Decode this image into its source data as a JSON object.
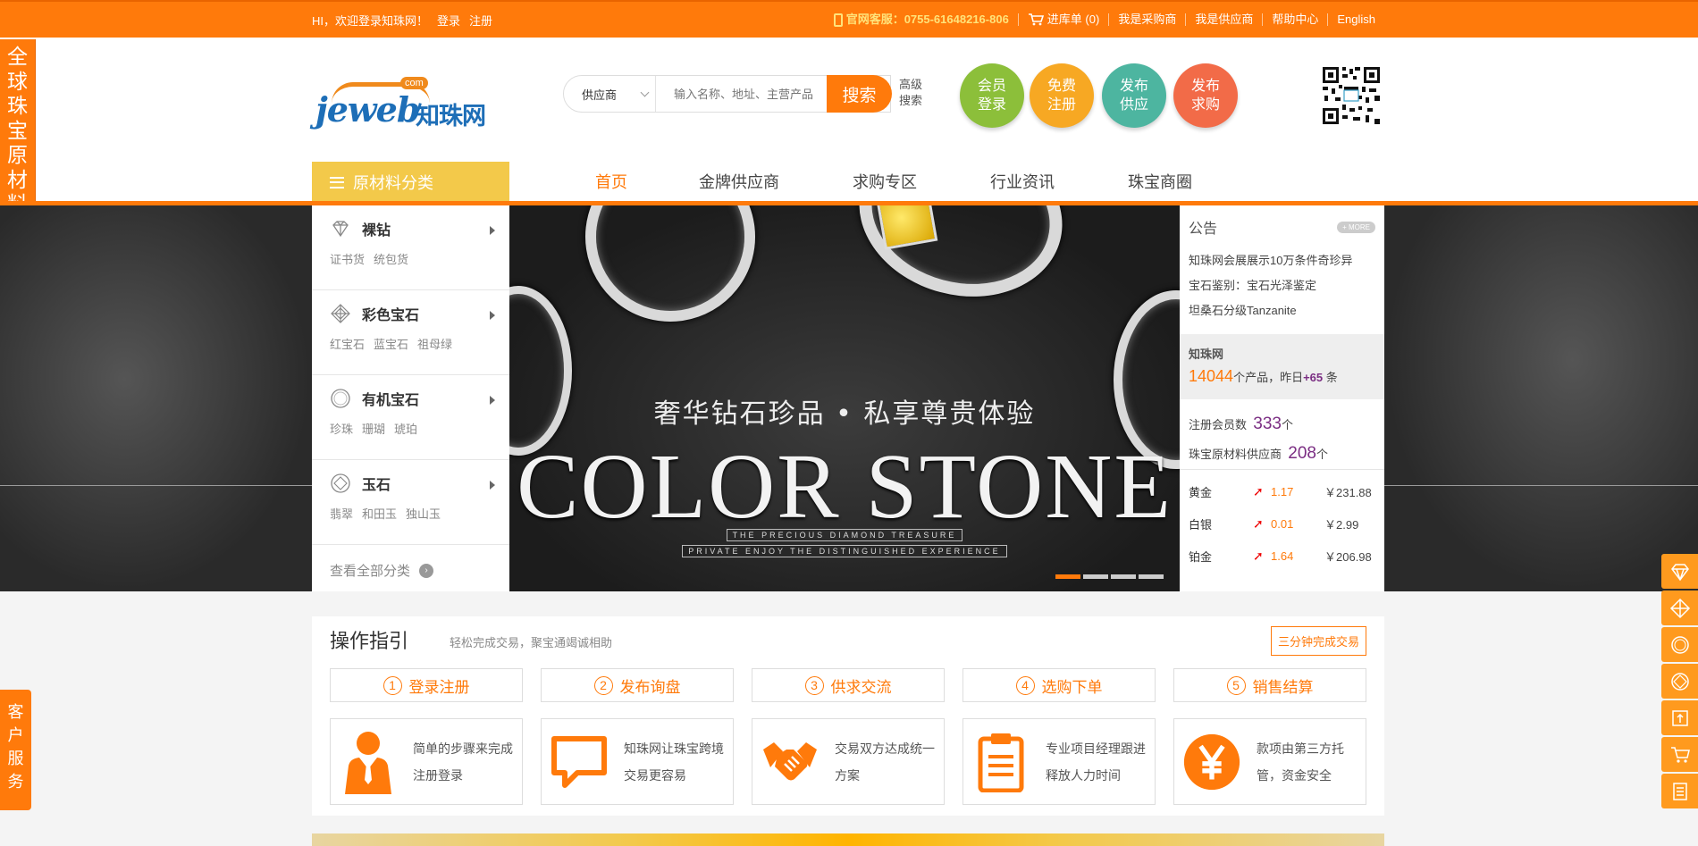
{
  "topbar": {
    "greeting": "HI，欢迎登录知珠网！",
    "login": "登录",
    "register": "注册",
    "hotline": "官网客服：0755-61648216-806",
    "cart": "进库单 (0)",
    "buyer": "我是采购商",
    "supplier": "我是供应商",
    "help": "帮助中心",
    "english": "English"
  },
  "left_banner": {
    "text": "全球珠宝原材料采销平台"
  },
  "left_service": {
    "text": "客户服务"
  },
  "logo": {
    "en": "jeweb",
    "cn": "知珠网",
    "badge": "com"
  },
  "search": {
    "scope": "供应商",
    "placeholder": "输入名称、地址、主营产品",
    "button": "搜索",
    "advanced_1": "高级",
    "advanced_2": "搜索"
  },
  "quick_buttons": [
    {
      "label_1": "会员",
      "label_2": "登录",
      "color": "#8cbf3a"
    },
    {
      "label_1": "免费",
      "label_2": "注册",
      "color": "#f7a823"
    },
    {
      "label_1": "发布",
      "label_2": "供应",
      "color": "#4db5a0"
    },
    {
      "label_1": "发布",
      "label_2": "求购",
      "color": "#f26b48"
    }
  ],
  "nav": {
    "category_title": "原材料分类",
    "items": [
      "首页",
      "金牌供应商",
      "求购专区",
      "行业资讯",
      "珠宝商圈"
    ]
  },
  "categories": [
    {
      "title": "裸钻",
      "subs": [
        "证书货",
        "统包货"
      ],
      "icon": "diamond-icon"
    },
    {
      "title": "彩色宝石",
      "subs": [
        "红宝石",
        "蓝宝石",
        "祖母绿"
      ],
      "icon": "gem-icon"
    },
    {
      "title": "有机宝石",
      "subs": [
        "珍珠",
        "珊瑚",
        "琥珀"
      ],
      "icon": "pearl-icon"
    },
    {
      "title": "玉石",
      "subs": [
        "翡翠",
        "和田玉",
        "独山玉"
      ],
      "icon": "jade-icon"
    }
  ],
  "category_all": "查看全部分类",
  "slider": {
    "tagline": "奢华钻石珍品 • 私享尊贵体验",
    "headline": "COLOR STONE",
    "sub1": "THE PRECIOUS DIAMOND TREASURE",
    "sub2": "PRIVATE ENJOY THE DISTINGUISHED EXPERIENCE",
    "active_slide": 1,
    "slide_count": 4
  },
  "panel": {
    "announce_title": "公告",
    "more": "+ MORE",
    "announcements": [
      "知珠网会展展示10万条件奇珍异",
      "宝石鉴别：宝石光泽鉴定",
      "坦桑石分级Tanzanite"
    ],
    "site_label": "知珠网",
    "product_count": "14044",
    "product_unit": "个产品，昨日",
    "product_inc": "+65",
    "product_inc_unit": "条",
    "members_label": "注册会员数",
    "members": "333",
    "members_unit": "个",
    "suppliers_label": "珠宝原材料供应商",
    "suppliers": "208",
    "suppliers_unit": "个",
    "prices": [
      {
        "name": "黄金",
        "change": "1.17",
        "price": "￥231.88"
      },
      {
        "name": "白银",
        "change": "0.01",
        "price": "￥2.99"
      },
      {
        "name": "铂金",
        "change": "1.64",
        "price": "￥206.98"
      }
    ]
  },
  "guide": {
    "title": "操作指引",
    "subtitle": "轻松完成交易，聚宝通竭诚相助",
    "button": "三分钟完成交易",
    "steps": [
      {
        "num": "1",
        "label": "登录注册",
        "text": "简单的步骤来完成注册登录",
        "icon": "person-icon"
      },
      {
        "num": "2",
        "label": "发布询盘",
        "text": "知珠网让珠宝跨境交易更容易",
        "icon": "chat-icon"
      },
      {
        "num": "3",
        "label": "供求交流",
        "text": "交易双方达成统一方案",
        "icon": "handshake-icon"
      },
      {
        "num": "4",
        "label": "选购下单",
        "text": "专业项目经理跟进释放人力时间",
        "icon": "clipboard-icon"
      },
      {
        "num": "5",
        "label": "销售结算",
        "text": "款项由第三方托管，资金安全",
        "icon": "yen-icon"
      }
    ]
  },
  "right_toolbar": [
    "diamond-icon",
    "gem-icon",
    "pearl-icon",
    "jade-icon",
    "box-icon",
    "cart-icon",
    "list-icon"
  ],
  "colors": {
    "brand": "#ff7a0b",
    "category_bg": "#f3c94a",
    "accent_purple": "#7b2e83"
  }
}
